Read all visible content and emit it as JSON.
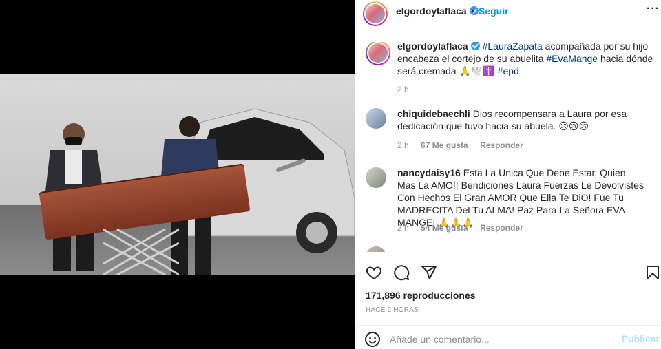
{
  "header": {
    "username": "elgordoylaflaca",
    "separator": "•",
    "follow_label": "Seguir",
    "more_icon": "more-horizontal-icon"
  },
  "caption": {
    "username": "elgordoylaflaca",
    "tag1": "#LauraZapata",
    "text1": " acompañada por su hijo encabeza el cortejo de su abuelita ",
    "tag2": "#EvaMange",
    "text2": " hacia dónde será cremada 🙏🕊️✝️ ",
    "tag3": "#epd",
    "time": "2 h"
  },
  "comments": [
    {
      "username": "chiquidebaechli",
      "text": "Dios recompensara a Laura por esa dedicación que tuvo hacia su abuela. 😢😢😢",
      "time": "2 h",
      "likes": "67 Me gusta",
      "reply": "Responder",
      "liked": true
    },
    {
      "username": "nancydaisy16",
      "text": "Esta La Unica Que Debe Estar, Quien Mas La AMO!! Bendiciones Laura Fuerzas Le Devolvistes Con Hechos El Gran AMOR Que Ella Te DiO! Fue Tu MADRECITA Del Tu ALMA! Paz Para La Señora EVA MANGE! 🙏🙏🙏",
      "time": "2 h",
      "likes": "54 Me gusta",
      "reply": "Responder",
      "liked": false
    }
  ],
  "actions": {
    "like_icon": "heart-icon",
    "comment_icon": "comment-icon",
    "share_icon": "share-icon",
    "save_icon": "bookmark-icon",
    "views": "171,896 reproducciones",
    "posted": "HACE 2 HORAS"
  },
  "add_comment": {
    "emoji_icon": "emoji-icon",
    "placeholder": "Añade un comentario...",
    "publish_label": "Publicar"
  },
  "colors": {
    "link": "#00376b",
    "follow": "#0095f6",
    "liked_heart": "#ed4956"
  }
}
